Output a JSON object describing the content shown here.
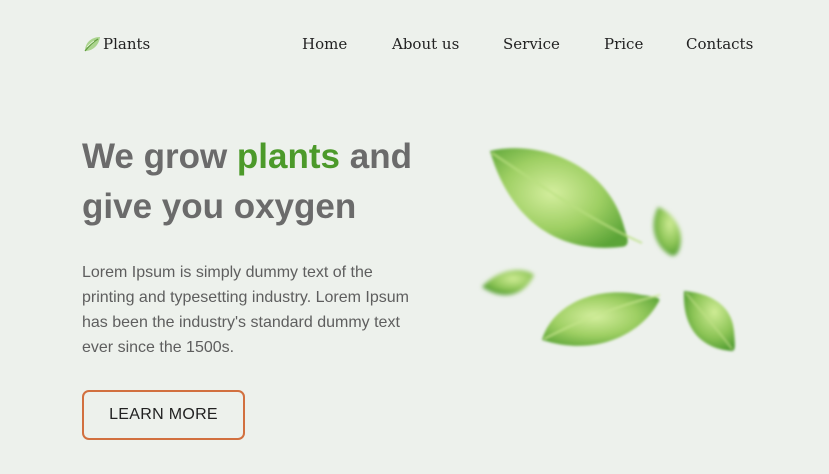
{
  "header": {
    "logo": {
      "icon": "leaf-icon",
      "text": "Plants"
    },
    "nav": [
      {
        "label": "Home"
      },
      {
        "label": "About us"
      },
      {
        "label": "Service"
      },
      {
        "label": "Price"
      },
      {
        "label": "Contacts"
      }
    ]
  },
  "hero": {
    "title_part1": "We grow ",
    "title_accent": "plants",
    "title_part2": " and give you oxygen",
    "description": "Lorem Ipsum is simply dummy text of the printing and typesetting industry. Lorem Ipsum has been the industry's standard dummy text ever since the 1500s.",
    "button_label": "LEARN MORE",
    "illustration": "falling-leaves-image"
  },
  "colors": {
    "background": "#edf1ec",
    "accent_green": "#4c9a2a",
    "heading_gray": "#6b6b6b",
    "button_border": "#d2703f"
  }
}
